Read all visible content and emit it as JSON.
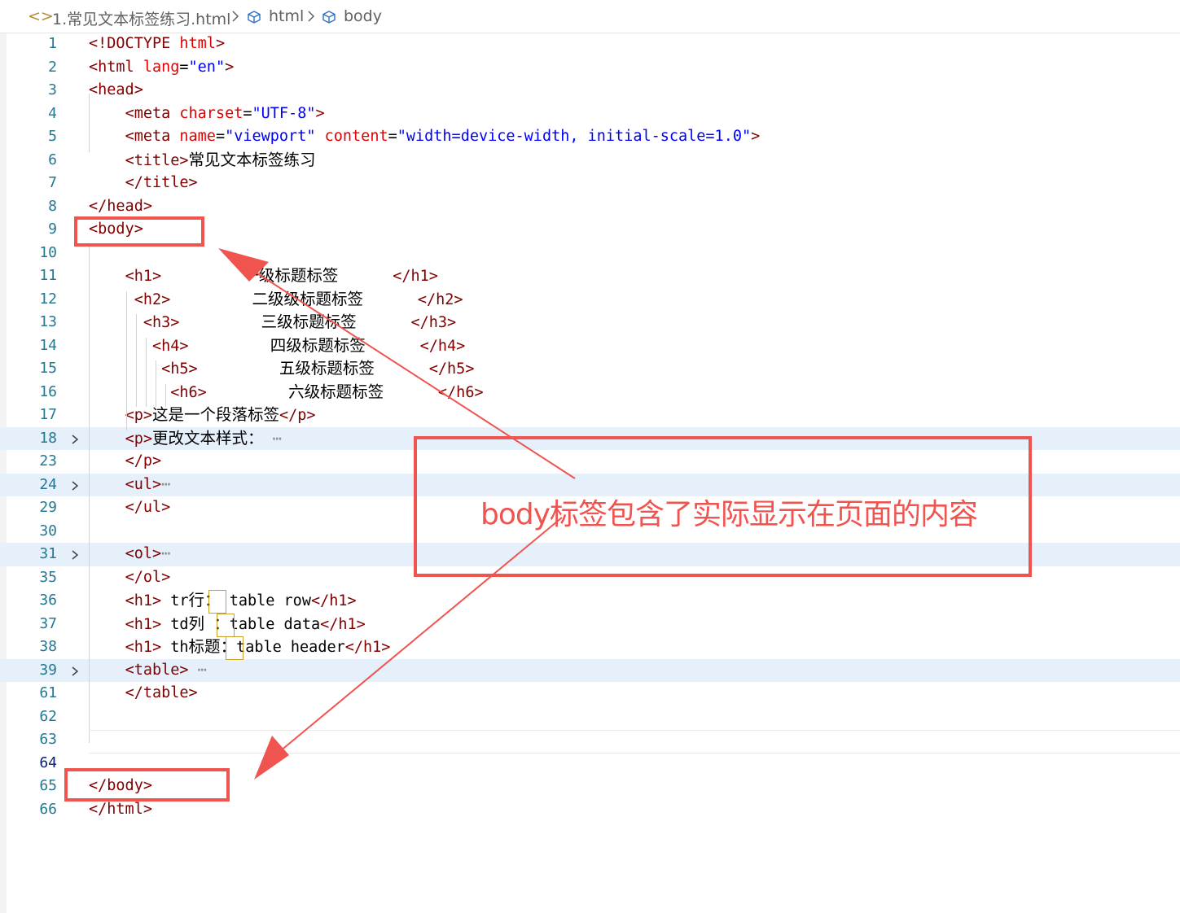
{
  "breadcrumb": {
    "file": "1.常见文本标签练习.html",
    "items": [
      "html",
      "body"
    ]
  },
  "annotation": {
    "text": "body标签包含了实际显示在页面的内容"
  },
  "colors": {
    "tag": "#800000",
    "attr": "#e50000",
    "value": "#0000ff",
    "line_number": "#237893",
    "highlight": "#e5f0fb",
    "annotation": "#f0544f"
  },
  "code_lines": [
    {
      "n": "1",
      "parts": [
        [
          "t",
          "<!DOCTYPE "
        ],
        [
          "a",
          "html"
        ],
        [
          "t",
          ">"
        ]
      ]
    },
    {
      "n": "2",
      "parts": [
        [
          "t",
          "<html "
        ],
        [
          "a",
          "lang"
        ],
        [
          "k",
          "="
        ],
        [
          "v",
          "\"en\""
        ],
        [
          "t",
          ">"
        ]
      ]
    },
    {
      "n": "3",
      "parts": [
        [
          "t",
          "<head>"
        ]
      ]
    },
    {
      "n": "4",
      "parts": [
        [
          "k",
          "    "
        ],
        [
          "t",
          "<meta "
        ],
        [
          "a",
          "charset"
        ],
        [
          "k",
          "="
        ],
        [
          "v",
          "\"UTF-8\""
        ],
        [
          "t",
          ">"
        ]
      ]
    },
    {
      "n": "5",
      "parts": [
        [
          "k",
          "    "
        ],
        [
          "t",
          "<meta "
        ],
        [
          "a",
          "name"
        ],
        [
          "k",
          "="
        ],
        [
          "v",
          "\"viewport\" "
        ],
        [
          "a",
          "content"
        ],
        [
          "k",
          "="
        ],
        [
          "v",
          "\"width=device-width, initial-scale=1.0\""
        ],
        [
          "t",
          ">"
        ]
      ]
    },
    {
      "n": "6",
      "parts": [
        [
          "k",
          "    "
        ],
        [
          "t",
          "<title>"
        ],
        [
          "cn",
          "常见文本标签练习"
        ]
      ]
    },
    {
      "n": "7",
      "parts": [
        [
          "k",
          "    "
        ],
        [
          "t",
          "</title>"
        ]
      ]
    },
    {
      "n": "8",
      "parts": [
        [
          "t",
          "</head>"
        ]
      ]
    },
    {
      "n": "9",
      "parts": [
        [
          "t",
          "<body>"
        ]
      ]
    },
    {
      "n": "10",
      "parts": []
    },
    {
      "n": "11",
      "parts": [
        [
          "k",
          "    "
        ],
        [
          "t",
          "<h1>"
        ],
        [
          "k",
          "         "
        ],
        [
          "cn",
          "一级标题标签"
        ],
        [
          "k",
          "      "
        ],
        [
          "t",
          "</h1>"
        ]
      ]
    },
    {
      "n": "12",
      "parts": [
        [
          "k",
          "     "
        ],
        [
          "t",
          "<h2>"
        ],
        [
          "k",
          "         "
        ],
        [
          "cn",
          "二级级标题标签"
        ],
        [
          "k",
          "      "
        ],
        [
          "t",
          "</h2>"
        ]
      ]
    },
    {
      "n": "13",
      "parts": [
        [
          "k",
          "      "
        ],
        [
          "t",
          "<h3>"
        ],
        [
          "k",
          "         "
        ],
        [
          "cn",
          "三级标题标签"
        ],
        [
          "k",
          "      "
        ],
        [
          "t",
          "</h3>"
        ]
      ]
    },
    {
      "n": "14",
      "parts": [
        [
          "k",
          "       "
        ],
        [
          "t",
          "<h4>"
        ],
        [
          "k",
          "         "
        ],
        [
          "cn",
          "四级标题标签"
        ],
        [
          "k",
          "      "
        ],
        [
          "t",
          "</h4>"
        ]
      ]
    },
    {
      "n": "15",
      "parts": [
        [
          "k",
          "        "
        ],
        [
          "t",
          "<h5>"
        ],
        [
          "k",
          "         "
        ],
        [
          "cn",
          "五级标题标签"
        ],
        [
          "k",
          "      "
        ],
        [
          "t",
          "</h5>"
        ]
      ]
    },
    {
      "n": "16",
      "parts": [
        [
          "k",
          "         "
        ],
        [
          "t",
          "<h6>"
        ],
        [
          "k",
          "         "
        ],
        [
          "cn",
          "六级标题标签"
        ],
        [
          "k",
          "      "
        ],
        [
          "t",
          "</h6>"
        ]
      ]
    },
    {
      "n": "17",
      "parts": [
        [
          "k",
          "    "
        ],
        [
          "t",
          "<p>"
        ],
        [
          "cn",
          "这是一个段落标签"
        ],
        [
          "t",
          "</p>"
        ]
      ]
    },
    {
      "n": "18",
      "parts": [
        [
          "k",
          "    "
        ],
        [
          "t",
          "<p>"
        ],
        [
          "cn",
          "更改文本样式："
        ],
        [
          "k",
          " "
        ],
        [
          "e",
          "⋯"
        ]
      ],
      "fold": true,
      "hl": true
    },
    {
      "n": "23",
      "parts": [
        [
          "k",
          "    "
        ],
        [
          "t",
          "</p>"
        ]
      ]
    },
    {
      "n": "24",
      "parts": [
        [
          "k",
          "    "
        ],
        [
          "t",
          "<ul>"
        ],
        [
          "e",
          "⋯"
        ]
      ],
      "fold": true,
      "hl": true
    },
    {
      "n": "29",
      "parts": [
        [
          "k",
          "    "
        ],
        [
          "t",
          "</ul>"
        ]
      ]
    },
    {
      "n": "30",
      "parts": []
    },
    {
      "n": "31",
      "parts": [
        [
          "k",
          "    "
        ],
        [
          "t",
          "<ol>"
        ],
        [
          "e",
          "⋯"
        ]
      ],
      "fold": true,
      "hl": true
    },
    {
      "n": "35",
      "parts": [
        [
          "k",
          "    "
        ],
        [
          "t",
          "</ol>"
        ]
      ]
    },
    {
      "n": "36",
      "parts": [
        [
          "k",
          "    "
        ],
        [
          "t",
          "<h1>"
        ],
        [
          "k",
          " tr"
        ],
        [
          "cn",
          "行"
        ],
        [
          "cn",
          "："
        ],
        [
          "k",
          " table row"
        ],
        [
          "t",
          "</h1>"
        ]
      ]
    },
    {
      "n": "37",
      "parts": [
        [
          "k",
          "    "
        ],
        [
          "t",
          "<h1>"
        ],
        [
          "k",
          " td"
        ],
        [
          "cn",
          "列"
        ],
        [
          "k",
          " "
        ],
        [
          "cn",
          "："
        ],
        [
          "k",
          "table data"
        ],
        [
          "t",
          "</h1>"
        ]
      ]
    },
    {
      "n": "38",
      "parts": [
        [
          "k",
          "    "
        ],
        [
          "t",
          "<h1>"
        ],
        [
          "k",
          " th"
        ],
        [
          "cn",
          "标题"
        ],
        [
          "cn",
          "："
        ],
        [
          "k",
          "table header"
        ],
        [
          "t",
          "</h1>"
        ]
      ]
    },
    {
      "n": "39",
      "parts": [
        [
          "k",
          "    "
        ],
        [
          "t",
          "<table>"
        ],
        [
          "k",
          " "
        ],
        [
          "e",
          "⋯"
        ]
      ],
      "fold": true,
      "hl": true
    },
    {
      "n": "61",
      "parts": [
        [
          "k",
          "    "
        ],
        [
          "t",
          "</table>"
        ]
      ]
    },
    {
      "n": "62",
      "parts": []
    },
    {
      "n": "63",
      "parts": []
    },
    {
      "n": "64",
      "parts": [],
      "current": true
    },
    {
      "n": "65",
      "parts": [
        [
          "t",
          "</body>"
        ]
      ]
    },
    {
      "n": "66",
      "parts": [
        [
          "t",
          "</html>"
        ]
      ]
    }
  ]
}
